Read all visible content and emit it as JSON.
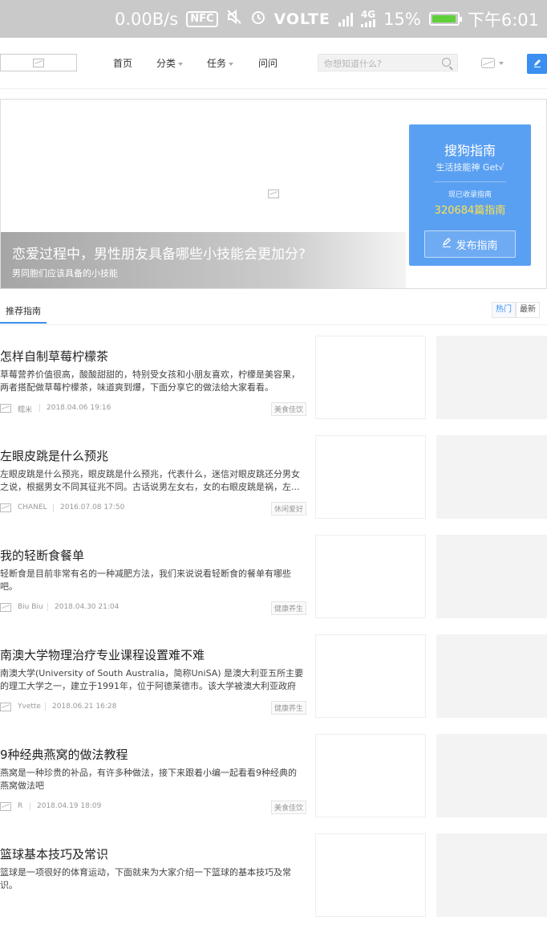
{
  "status_bar": {
    "speed": "0.00B/s",
    "nfc": "NFC",
    "volte": "VOLTE",
    "network": "4G",
    "battery": "15%",
    "battery_level": 0.15,
    "time": "下午6:01"
  },
  "header": {
    "nav": {
      "home": "首页",
      "category": "分类",
      "tasks": "任务",
      "ask": "问问"
    },
    "search_placeholder": "你想知道什么?"
  },
  "banner": {
    "title": "恋爱过程中，男性朋友具备哪些小技能会更加分?",
    "subtitle": "男同胞们应该具备的小技能",
    "promo": {
      "title": "搜狗指南",
      "slogan": "生活技能神 Get√",
      "count_label": "现已收录指南",
      "count": "320684篇指南",
      "button": "发布指南"
    }
  },
  "tabs": {
    "recommend": "推荐指南",
    "sort_hot": "热门",
    "sort_new": "最新"
  },
  "colors": {
    "accent": "#3a8ff0",
    "promo_bg": "#5aa0f2",
    "count_highlight": "#ffe24a",
    "status_bar": "#c9c9c9"
  },
  "articles": [
    {
      "title": "怎样自制草莓柠檬茶",
      "desc": "草莓营养价值很高，酸酸甜甜的，特别受女孩和小朋友喜欢，柠檬是美容果，两者搭配做草莓柠檬茶，味道爽到爆，下面分享它的做法给大家看看。",
      "author": "糯米",
      "date": "2018.04.06 19:16",
      "tag": "美食佳饮"
    },
    {
      "title": "左眼皮跳是什么预兆",
      "desc": "左眼皮跳是什么预兆，眼皮跳是什么预兆，代表什么，迷信对眼皮跳还分男女之说，根据男女不同其征兆不同。古话说男左女右，女的右眼皮跳是祸，左...",
      "author": "CHANEL",
      "date": "2016.07.08 17:50",
      "tag": "休闲爱好"
    },
    {
      "title": "我的轻断食餐单",
      "desc": "轻断食是目前非常有名的一种减肥方法，我们来说说看轻断食的餐单有哪些吧。",
      "author": "Biu Biu",
      "date": "2018.04.30 21:04",
      "tag": "健康养生"
    },
    {
      "title": "南澳大学物理治疗专业课程设置难不难",
      "desc": "南澳大学(University of South Australia，简称UniSA) 是澳大利亚五所主要的理工大学之一，建立于1991年，位于阿德莱德市。该大学被澳大利亚政府指...",
      "author": "Yvette",
      "date": "2018.06.21 16:28",
      "tag": "健康养生"
    },
    {
      "title": "9种经典燕窝的做法教程",
      "desc": "燕窝是一种珍贵的补品，有许多种做法，接下来跟着小编一起看看9种经典的燕窝做法吧",
      "author": "R",
      "date": "2018.04.19 18:09",
      "tag": "美食佳饮"
    },
    {
      "title": "篮球基本技巧及常识",
      "desc": "篮球是一项很好的体育运动，下面就来为大家介绍一下篮球的基本技巧及常识。",
      "author": "",
      "date": "",
      "tag": ""
    }
  ]
}
